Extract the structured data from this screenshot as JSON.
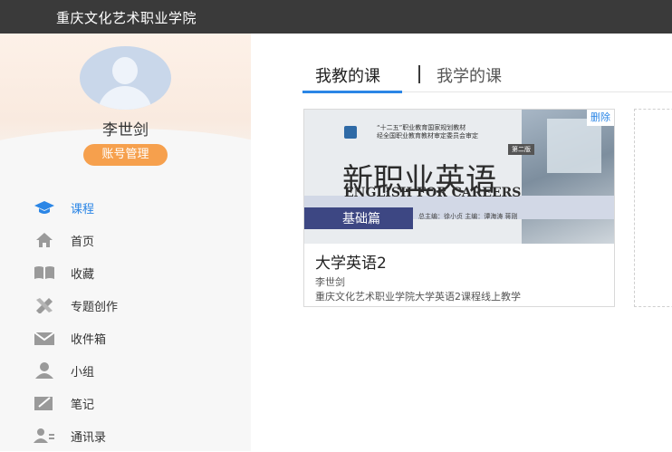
{
  "header": {
    "school_name": "重庆文化艺术职业学院"
  },
  "profile": {
    "name": "李世剑",
    "account_button": "账号管理"
  },
  "sidebar": {
    "items": [
      {
        "label": "课程",
        "icon": "graduation-cap-icon",
        "active": true
      },
      {
        "label": "首页",
        "icon": "home-icon",
        "active": false
      },
      {
        "label": "收藏",
        "icon": "book-icon",
        "active": false
      },
      {
        "label": "专题创作",
        "icon": "pencil-ruler-icon",
        "active": false
      },
      {
        "label": "收件箱",
        "icon": "inbox-icon",
        "active": false
      },
      {
        "label": "小组",
        "icon": "user-icon",
        "active": false
      },
      {
        "label": "笔记",
        "icon": "notebook-icon",
        "active": false
      },
      {
        "label": "通讯录",
        "icon": "contacts-icon",
        "active": false
      }
    ]
  },
  "main": {
    "tabs": [
      {
        "label": "我教的课",
        "active": true
      },
      {
        "label": "我学的课",
        "active": false
      }
    ],
    "courses": [
      {
        "title": "大学英语2",
        "teacher": "李世剑",
        "description": "重庆文化艺术职业学院大学英语2课程线上教学",
        "delete_label": "删除",
        "cover": {
          "title_cn": "新职业英语",
          "title_en": "ENGLISH FOR CAREERS",
          "band": "基础篇",
          "top_line1": "“十二五”职业教育国家规划教材",
          "top_line2": "经全国职业教育教材审定委员会审定",
          "edition": "第二版",
          "editors": "总主编：徐小贞  主编：谭海涛  蒋刚"
        }
      }
    ]
  },
  "colors": {
    "accent": "#2b86e6",
    "orange": "#f6a04d",
    "topbar": "#3a3a3a"
  }
}
